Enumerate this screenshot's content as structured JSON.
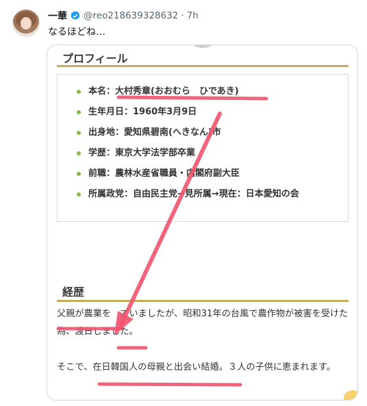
{
  "post": {
    "author_name": "一華",
    "handle": "@reo218639328632",
    "separator": "·",
    "time": "7h",
    "text": "なるほどね…"
  },
  "image": {
    "profile_heading": "プロフィール",
    "profile_items": [
      "本名：大村秀章(おおむら　ひであき)",
      "生年月日：1960年3月9日",
      "出身地：愛知県碧南(へきなん)市",
      "学歴：東京大学法学部卒業",
      "前職：農林水産省職員・内閣府副大臣",
      "所属政党：自由民主党→見所属→現在：日本愛知の会"
    ],
    "career_heading": "経歴",
    "career_paragraphs": [
      "父親が農業を　ていましたが、昭和31年の台風で農作物が被害を受けた為、渡日しました。",
      "そこで、在日韓国人の母親と出会い結婚。３人の子供に恵まれます。"
    ]
  },
  "colors": {
    "accent_rule": "#c9a95b",
    "bullet": "#8bb84a",
    "annotation": "#f0546e",
    "verified": "#1d9bf0"
  }
}
